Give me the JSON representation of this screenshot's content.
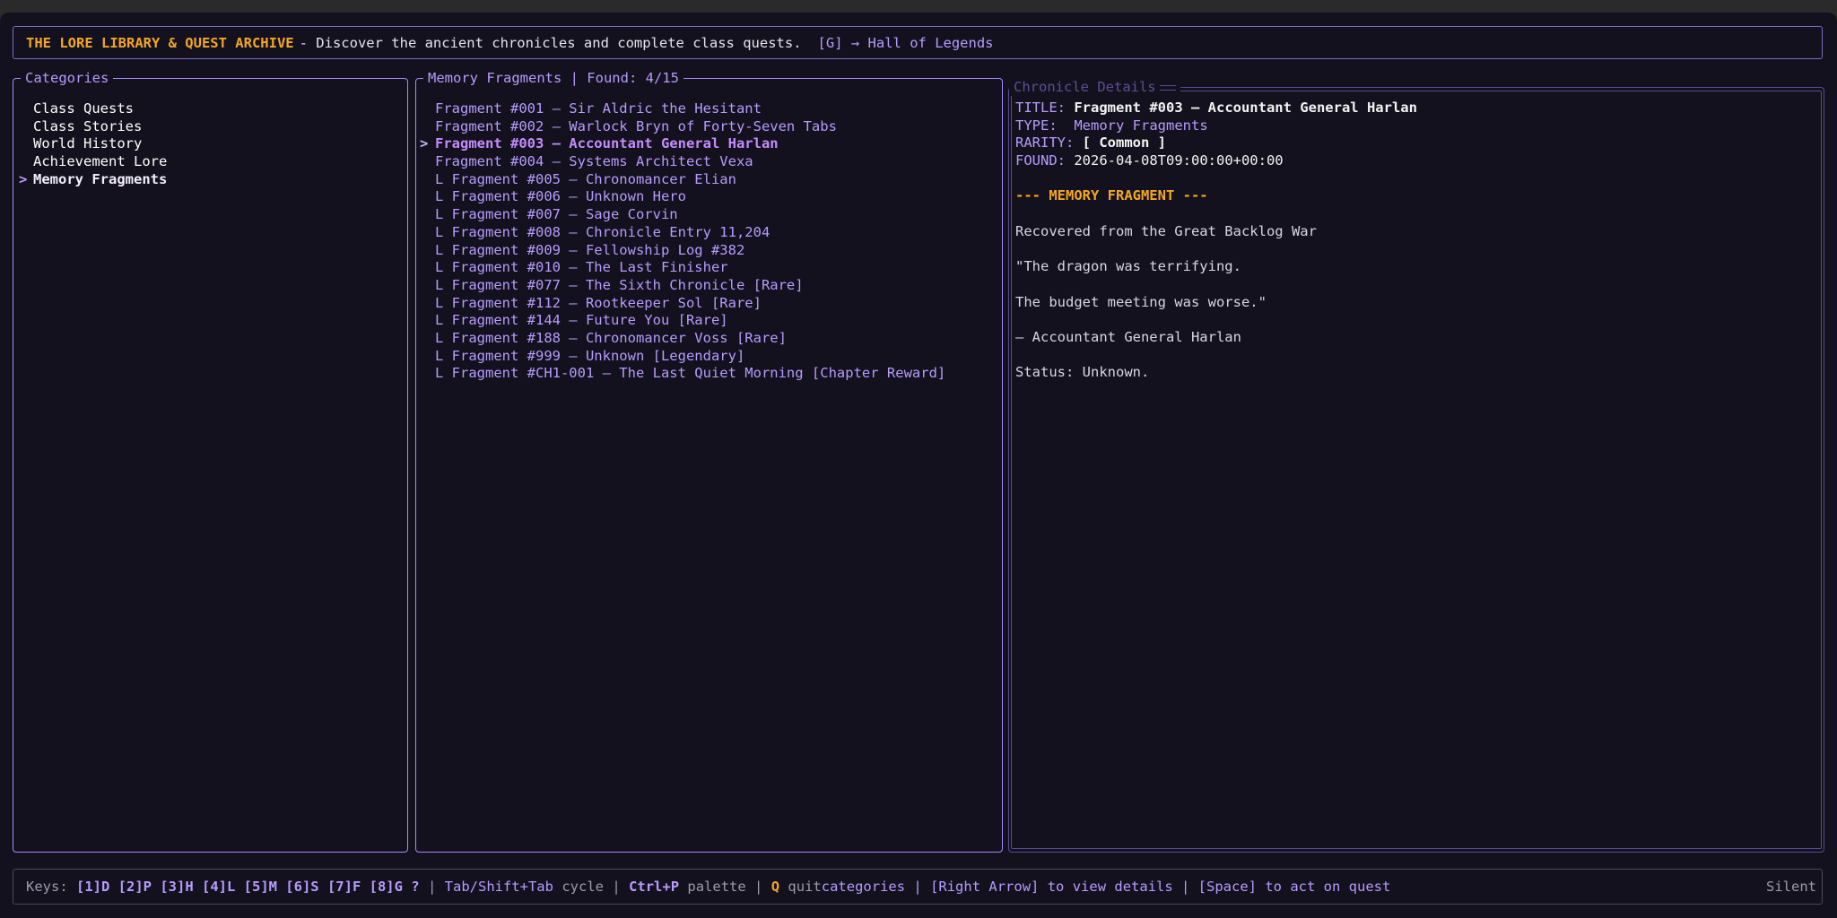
{
  "header": {
    "title": "THE LORE LIBRARY & QUEST ARCHIVE",
    "subtitle": "- Discover the ancient chronicles and complete class quests.",
    "link": "[G] → Hall of Legends"
  },
  "categories": {
    "title": "Categories",
    "items": [
      {
        "label": "Class Quests",
        "marker": ""
      },
      {
        "label": "Class Stories",
        "marker": ""
      },
      {
        "label": "World History",
        "marker": ""
      },
      {
        "label": "Achievement Lore",
        "marker": ""
      },
      {
        "label": "Memory Fragments",
        "marker": ">"
      }
    ]
  },
  "fragments": {
    "title": "Memory Fragments | Found: 4/15",
    "items": [
      {
        "label": "Fragment #001 — Sir Aldric the Hesitant",
        "marker": ""
      },
      {
        "label": "Fragment #002 — Warlock Bryn of Forty-Seven Tabs",
        "marker": ""
      },
      {
        "label": "Fragment #003 — Accountant General Harlan",
        "marker": ">"
      },
      {
        "label": "Fragment #004 — Systems Architect Vexa",
        "marker": ""
      },
      {
        "label": "L Fragment #005 — Chronomancer Elian",
        "marker": ""
      },
      {
        "label": "L Fragment #006 — Unknown Hero",
        "marker": ""
      },
      {
        "label": "L Fragment #007 — Sage Corvin",
        "marker": ""
      },
      {
        "label": "L Fragment #008 — Chronicle Entry 11,204",
        "marker": ""
      },
      {
        "label": "L Fragment #009 — Fellowship Log #382",
        "marker": ""
      },
      {
        "label": "L Fragment #010 — The Last Finisher",
        "marker": ""
      },
      {
        "label": "L Fragment #077 — The Sixth Chronicle [Rare]",
        "marker": ""
      },
      {
        "label": "L Fragment #112 — Rootkeeper Sol [Rare]",
        "marker": ""
      },
      {
        "label": "L Fragment #144 — Future You [Rare]",
        "marker": ""
      },
      {
        "label": "L Fragment #188 — Chronomancer Voss [Rare]",
        "marker": ""
      },
      {
        "label": "L Fragment #999 — Unknown [Legendary]",
        "marker": ""
      },
      {
        "label": "L Fragment #CH1-001 — The Last Quiet Morning [Chapter Reward]",
        "marker": ""
      }
    ]
  },
  "details": {
    "title": "Chronicle Details",
    "title_label": "TITLE:",
    "title_value": "Fragment #003 — Accountant General Harlan",
    "type_label": "TYPE:",
    "type_value": "Memory Fragments",
    "rarity_label": "RARITY:",
    "rarity_value": "[ Common ]",
    "found_label": "FOUND:",
    "found_value": "2026-04-08T09:00:00+00:00",
    "section_heading": "--- MEMORY FRAGMENT ---",
    "lines": [
      "Recovered from the Great Backlog War",
      "\"The dragon was terrifying.",
      "The budget meeting was worse.\"",
      "— Accountant General Harlan",
      "Status: Unknown."
    ]
  },
  "statusbar": {
    "keys_label": "Keys:",
    "shortcuts": "[1]D [2]P [3]H [4]L [5]M [6]S [7]F [8]G ?",
    "sep": "|",
    "cycle_keys": "Tab/Shift+Tab",
    "cycle_desc": "cycle",
    "palette_key": "Ctrl+P",
    "palette_desc": "palette",
    "quit_key": "Q",
    "quit_desc": "quit",
    "hints": "categories | [Right Arrow] to view details | [Space] to act on quest",
    "mode": "Silent"
  },
  "colors": {
    "background": "#13111d",
    "accent": "#b79bff",
    "highlight": "#f5a623",
    "border": "#a78bfa"
  }
}
